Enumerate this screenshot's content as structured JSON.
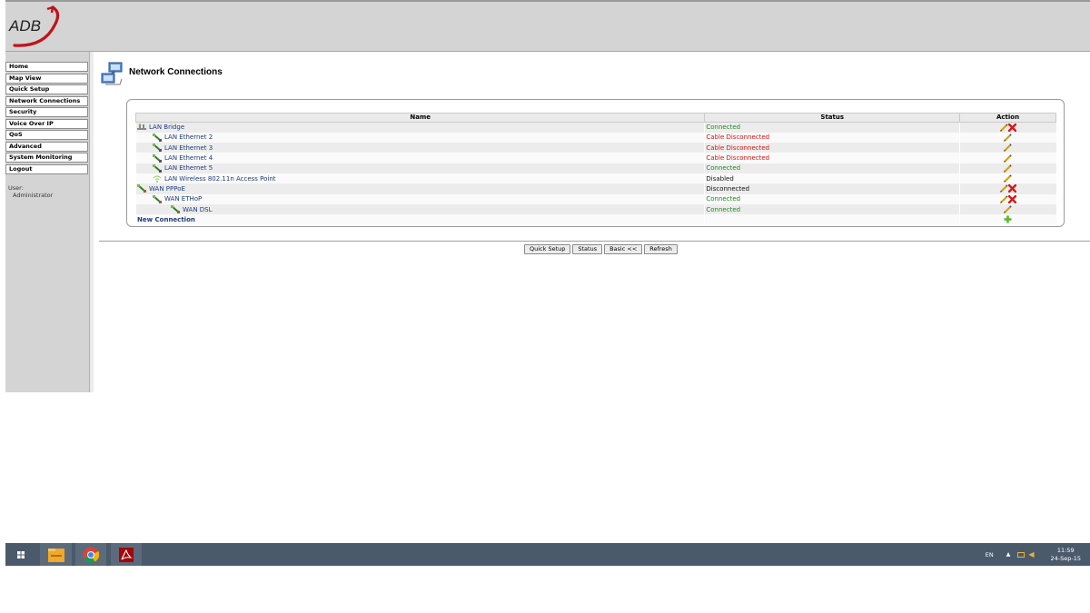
{
  "brand": {
    "logo_text": "ADB",
    "accent": "#c0131b"
  },
  "sidebar": {
    "items": [
      {
        "label": "Home"
      },
      {
        "label": "Map View"
      },
      {
        "label": "Quick Setup"
      },
      {
        "label": "Network Connections"
      },
      {
        "label": "Security"
      },
      {
        "label": "Voice Over IP"
      },
      {
        "label": "QoS"
      },
      {
        "label": "Advanced"
      },
      {
        "label": "System Monitoring"
      },
      {
        "label": "Logout"
      }
    ],
    "user_label": "User:",
    "user_name": "Administrator"
  },
  "page": {
    "title": "Network Connections",
    "icon": "network-connections-icon"
  },
  "table": {
    "headers": {
      "name": "Name",
      "status": "Status",
      "action": "Action"
    },
    "rows": [
      {
        "name": "LAN Bridge",
        "status": "Connected",
        "status_kind": "ok",
        "indent": 0,
        "icon": "bridge-icon",
        "edit": true,
        "delete": true
      },
      {
        "name": "LAN Ethernet 2",
        "status": "Cable Disconnected",
        "status_kind": "bad",
        "indent": 1,
        "icon": "ethernet-icon",
        "edit": true,
        "delete": false
      },
      {
        "name": "LAN Ethernet 3",
        "status": "Cable Disconnected",
        "status_kind": "bad",
        "indent": 1,
        "icon": "ethernet-icon",
        "edit": true,
        "delete": false
      },
      {
        "name": "LAN Ethernet 4",
        "status": "Cable Disconnected",
        "status_kind": "bad",
        "indent": 1,
        "icon": "ethernet-icon",
        "edit": true,
        "delete": false
      },
      {
        "name": "LAN Ethernet 5",
        "status": "Connected",
        "status_kind": "ok",
        "indent": 1,
        "icon": "ethernet-icon",
        "edit": true,
        "delete": false
      },
      {
        "name": "LAN Wireless 802.11n Access Point",
        "status": "Disabled",
        "status_kind": "dis",
        "indent": 1,
        "icon": "wireless-icon",
        "edit": true,
        "delete": false
      },
      {
        "name": "WAN PPPoE",
        "status": "Disconnected",
        "status_kind": "dis",
        "indent": 0,
        "icon": "wan-icon",
        "edit": true,
        "delete": true
      },
      {
        "name": "WAN ETHoP",
        "status": "Connected",
        "status_kind": "ok",
        "indent": 1,
        "icon": "wan-icon",
        "edit": true,
        "delete": true
      },
      {
        "name": "WAN DSL",
        "status": "Connected",
        "status_kind": "ok",
        "indent": 2,
        "icon": "wan-icon",
        "edit": true,
        "delete": false
      }
    ],
    "new_connection": "New Connection"
  },
  "buttons": {
    "quick_setup": "Quick Setup",
    "status": "Status",
    "basic": "Basic <<",
    "refresh": "Refresh"
  },
  "taskbar": {
    "apps": [
      "start-icon",
      "file-explorer-icon",
      "chrome-icon",
      "acrobat-icon"
    ],
    "lang": "EN",
    "time": "11:59",
    "date": "24-Sep-15"
  },
  "colors": {
    "ok": "#1c8a1c",
    "bad": "#e01010",
    "link": "#1c3c7a",
    "taskbar": "#4b5a6b"
  }
}
